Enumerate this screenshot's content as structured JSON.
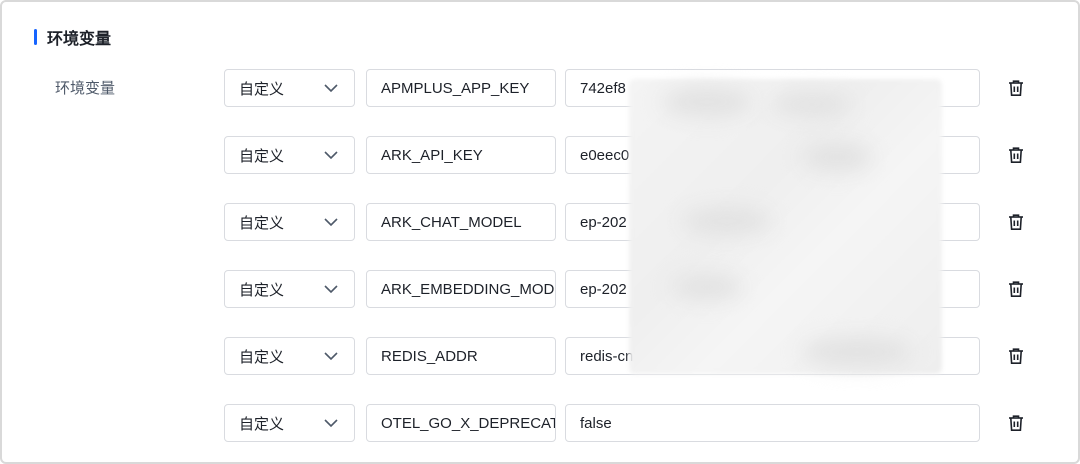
{
  "section": {
    "title": "环境变量"
  },
  "field_label": "环境变量",
  "env_vars": [
    {
      "type": "自定义",
      "key": "APMPLUS_APP_KEY",
      "value": "742ef8"
    },
    {
      "type": "自定义",
      "key": "ARK_API_KEY",
      "value": "e0eec0"
    },
    {
      "type": "自定义",
      "key": "ARK_CHAT_MODEL",
      "value": "ep-202"
    },
    {
      "type": "自定义",
      "key": "ARK_EMBEDDING_MODEL",
      "value": "ep-202"
    },
    {
      "type": "自定义",
      "key": "REDIS_ADDR",
      "value": "redis-cn"
    },
    {
      "type": "自定义",
      "key": "OTEL_GO_X_DEPRECATED",
      "value": "false"
    }
  ],
  "icons": {
    "chevron": "chevron-down-icon",
    "delete": "trash-icon"
  },
  "colors": {
    "accent": "#1664ff",
    "border": "#d9dbe0",
    "label": "#4e5969"
  }
}
